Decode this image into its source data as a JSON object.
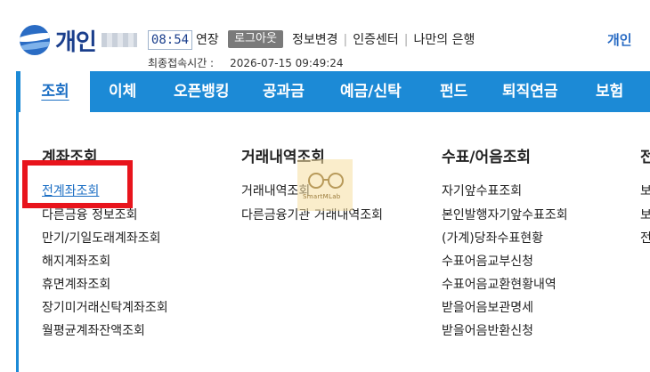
{
  "header": {
    "logo_text": "개인",
    "session_timer": "08:54",
    "extend_label": "연장",
    "logout_label": "로그아웃",
    "util_links": [
      "정보변경",
      "인증센터",
      "나만의 은행"
    ],
    "last_login_label": "최종접속시간 :",
    "last_login_value": "2026-07-15 09:49:24",
    "right_tab_label": "개인"
  },
  "nav": {
    "items": [
      "조회",
      "이체",
      "오픈뱅킹",
      "공과금",
      "예금/신탁",
      "펀드",
      "퇴직연금",
      "보험"
    ],
    "active_index": 0
  },
  "menu": {
    "columns": [
      {
        "title": "계좌조회",
        "links": [
          "전계좌조회",
          "다른금융 정보조회",
          "만기/기일도래계좌조회",
          "해지계좌조회",
          "휴면계좌조회",
          "장기미거래신탁계좌조회",
          "월평균계좌잔액조회"
        ]
      },
      {
        "title": "거래내역조회",
        "links": [
          "거래내역조회",
          "다른금융기관 거래내역조회"
        ]
      },
      {
        "title": "수표/어음조회",
        "links": [
          "자기앞수표조회",
          "본인발행자기앞수표조회",
          "(가계)당좌수표현황",
          "수표어음교부신청",
          "수표어음교환현황내역",
          "받을어음보관명세",
          "받을어음반환신청"
        ]
      },
      {
        "title": "전",
        "links": [
          "보",
          "보",
          "전"
        ]
      }
    ]
  },
  "watermark": {
    "text": "SmartMLab"
  },
  "colors": {
    "nav_bg": "#1c8ad6",
    "highlight": "#e8141c",
    "link_active": "#1c6fc4",
    "brand": "#1a3e8c"
  }
}
